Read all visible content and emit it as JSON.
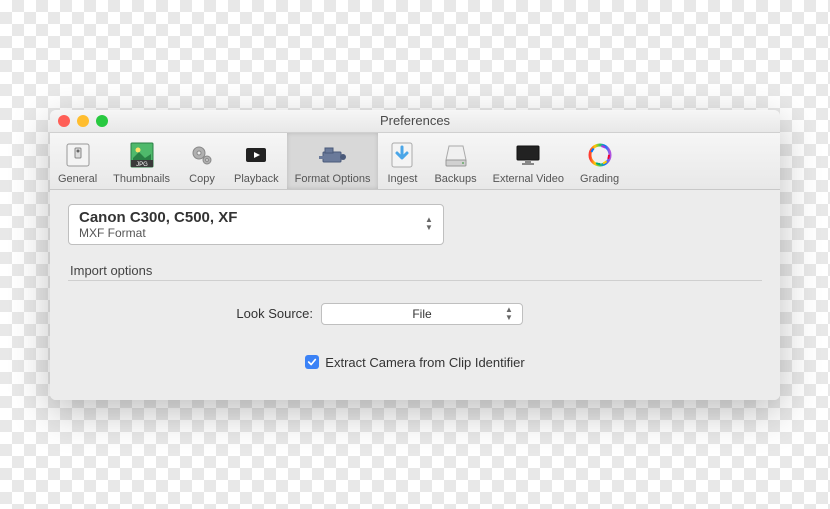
{
  "window": {
    "title": "Preferences"
  },
  "toolbar": {
    "items": [
      {
        "label": "General"
      },
      {
        "label": "Thumbnails"
      },
      {
        "label": "Copy"
      },
      {
        "label": "Playback"
      },
      {
        "label": "Format Options"
      },
      {
        "label": "Ingest"
      },
      {
        "label": "Backups"
      },
      {
        "label": "External Video"
      },
      {
        "label": "Grading"
      }
    ]
  },
  "format": {
    "title": "Canon C300, C500, XF",
    "subtitle": "MXF Format"
  },
  "import": {
    "group_label": "Import options",
    "look_source_label": "Look Source:",
    "look_source_value": "File",
    "extract_label": "Extract Camera from Clip Identifier"
  }
}
